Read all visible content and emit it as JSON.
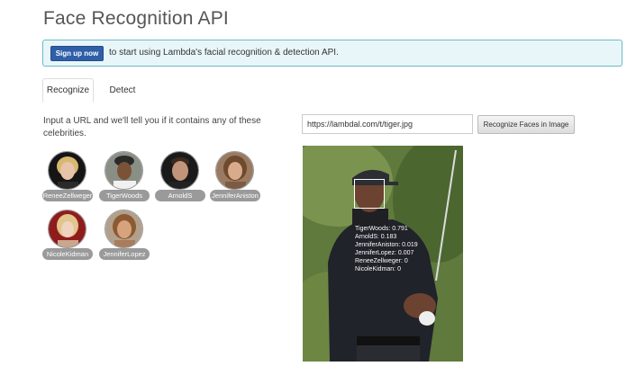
{
  "page": {
    "title": "Face Recognition API"
  },
  "alert": {
    "button_label": "Sign up now",
    "text": "to start using Lambda's facial recognition & detection API."
  },
  "tabs": [
    {
      "label": "Recognize",
      "active": true
    },
    {
      "label": "Detect",
      "active": false
    }
  ],
  "intro": "Input a URL and we'll tell you if it contains any of these celebrities.",
  "celebrities": [
    {
      "name": "ReneeZellweger"
    },
    {
      "name": "TigerWoods"
    },
    {
      "name": "ArnoldS"
    },
    {
      "name": "JenniferAniston"
    },
    {
      "name": "NicoleKidman"
    },
    {
      "name": "JenniferLopez"
    }
  ],
  "url_input": {
    "value": "https://lambdal.com/t/tiger.jpg"
  },
  "recognize_button": {
    "label": "Recognize Faces in Image"
  },
  "results": [
    "TigerWoods: 0.791",
    "ArnoldS: 0.183",
    "JenniferAniston: 0.019",
    "JenniferLopez: 0.007",
    "ReneeZellweger: 0",
    "NicoleKidman: 0"
  ]
}
